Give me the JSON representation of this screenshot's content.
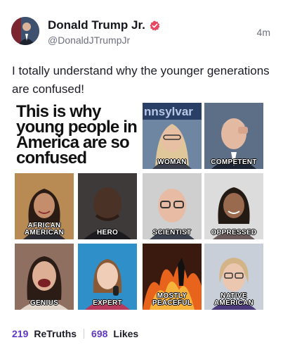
{
  "post": {
    "author_name": "Donald Trump Jr.",
    "handle": "@DonaldJTrumpJr",
    "time": "4m",
    "text": "I totally understand why the younger generations are confused!"
  },
  "meme": {
    "title": "This is why young people in America are so confused",
    "partial_sign_text": "nnsylvar",
    "tiles": [
      {
        "label": "WOMAN"
      },
      {
        "label": "COMPETENT"
      },
      {
        "label": "AFRICAN\nAMERICAN"
      },
      {
        "label": "HERO"
      },
      {
        "label": "SCIENTIST"
      },
      {
        "label": "OPPRESSED"
      },
      {
        "label": "GENIUS"
      },
      {
        "label": "EXPERT"
      },
      {
        "label": "MOSTLY\nPEACEFUL"
      },
      {
        "label": "NATIVE\nAMERICAN"
      }
    ]
  },
  "stats": {
    "retruths_count": "219",
    "retruths_label": "ReTruths",
    "likes_count": "698",
    "likes_label": "Likes"
  },
  "colors": {
    "accent": "#5f37c4",
    "verified": "#e8475f",
    "muted": "#6e6e80"
  }
}
